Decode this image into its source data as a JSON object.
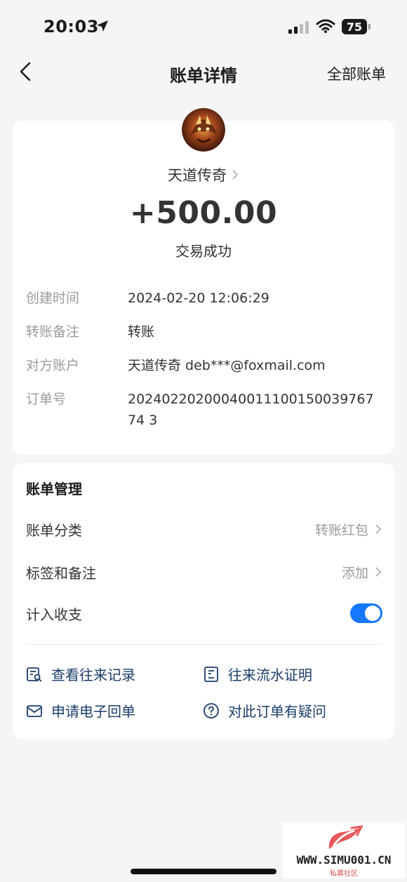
{
  "status_bar": {
    "time": "20:03",
    "battery": "75",
    "icons": [
      "location-arrow-icon",
      "signal-icon",
      "wifi-icon",
      "battery-icon"
    ]
  },
  "nav": {
    "title": "账单详情",
    "right_label": "全部账单",
    "back_icon": "chevron-left-icon"
  },
  "detail": {
    "payee": "天道传奇",
    "amount": "+500.00",
    "status": "交易成功",
    "rows": [
      {
        "label": "创建时间",
        "value": "2024-02-20 12:06:29"
      },
      {
        "label": "转账备注",
        "value": "转账"
      },
      {
        "label": "对方账户",
        "value": "天道传奇 deb***@foxmail.com"
      },
      {
        "label": "订单号",
        "value": "2024022020004001110015003976774 3"
      }
    ]
  },
  "manage": {
    "title": "账单管理",
    "category_label": "账单分类",
    "category_value": "转账红包",
    "tags_label": "标签和备注",
    "tags_value": "添加",
    "include_label": "计入收支",
    "include_on": true,
    "actions": [
      {
        "label": "查看往来记录",
        "icon": "record-search-icon"
      },
      {
        "label": "往来流水证明",
        "icon": "statement-icon"
      },
      {
        "label": "申请电子回单",
        "icon": "mail-icon"
      },
      {
        "label": "对此订单有疑问",
        "icon": "question-circle-icon"
      }
    ]
  },
  "watermark": {
    "text": "WWW.SIMU001.CN",
    "sub": "私募社区"
  },
  "colors": {
    "background": "#f5f5f5",
    "accent": "#1677ff",
    "action_text": "#1a3d6b",
    "muted": "#9a9a9a"
  }
}
